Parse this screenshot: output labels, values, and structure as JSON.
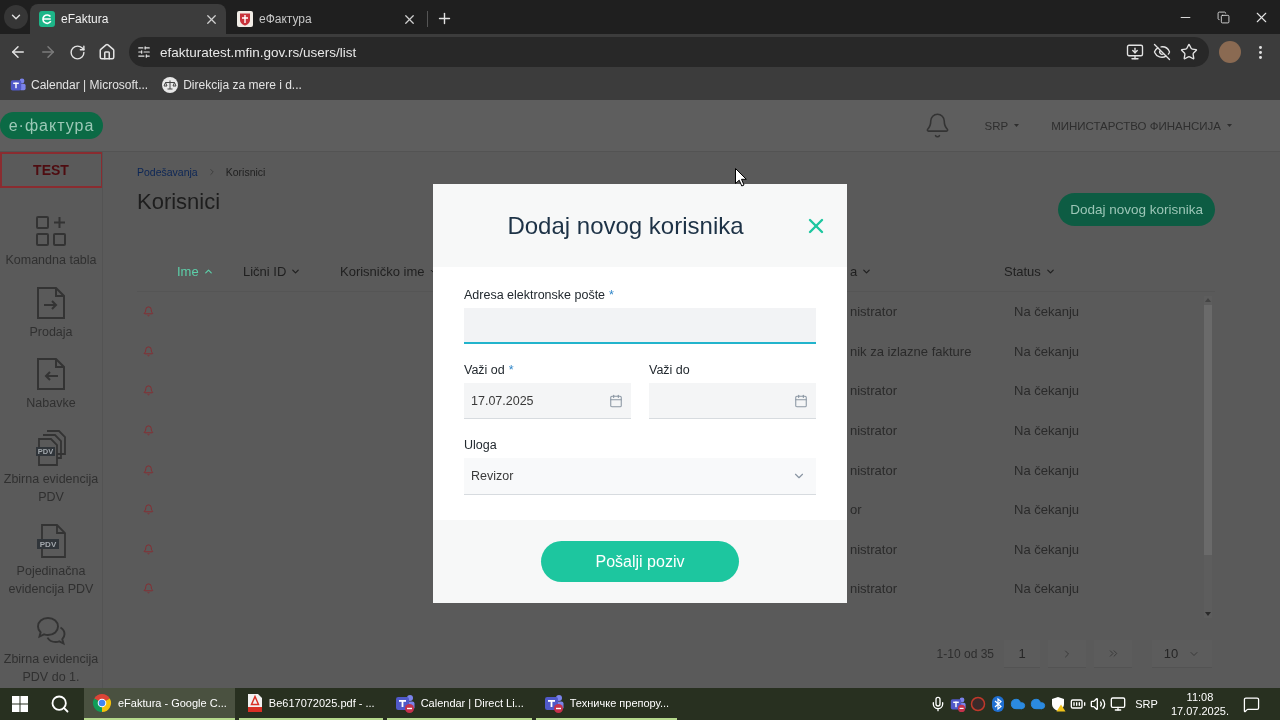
{
  "browser": {
    "tabs": [
      {
        "title": "eFaktura",
        "kind": "efaktura",
        "selected": true
      },
      {
        "title": "еФактура",
        "kind": "crest",
        "selected": false
      }
    ],
    "url": "efakturatest.mfin.gov.rs/users/list",
    "bookmarks": [
      {
        "kind": "teams",
        "label": "Calendar | Microsoft..."
      },
      {
        "kind": "scale",
        "label": "Direkcija za mere i d..."
      }
    ]
  },
  "header": {
    "logo": "e·фактура",
    "language": "SRP",
    "organization": "МИНИСТАРСТВО ФИНАНСИЈА"
  },
  "sidebar": {
    "badge": "TEST",
    "items": [
      {
        "kind": "dashboard",
        "label": "Komandna tabla"
      },
      {
        "kind": "outgoing",
        "label": "Prodaja"
      },
      {
        "kind": "incoming",
        "label": "Nabavke"
      },
      {
        "kind": "pdv-stack",
        "label": "Zbirna evidencija PDV",
        "icon_text": "PDV"
      },
      {
        "kind": "pdv-single",
        "label": "Pojedinačna evidencija PDV",
        "icon_text": "PDV"
      },
      {
        "kind": "chat",
        "label": "Zbirna evidencija PDV do 1."
      }
    ]
  },
  "breadcrumb": [
    {
      "kind": "link",
      "label": "Podešavanja"
    },
    {
      "kind": "current",
      "label": "Korisnici"
    }
  ],
  "page_title": "Korisnici",
  "add_button": "Dodaj novog korisnika",
  "table": {
    "columns": [
      {
        "label": "Ime",
        "selected": true
      },
      {
        "label": "Lični ID",
        "selected": false
      },
      {
        "label": "Korisničko ime",
        "selected": false
      },
      {
        "label": "a",
        "selected": false
      },
      {
        "label": "Status",
        "selected": false
      }
    ],
    "rows": [
      {
        "role": "nistrator",
        "status": "Na čekanju"
      },
      {
        "role": "nik za izlazne fakture",
        "status": "Na čekanju"
      },
      {
        "role": "nistrator",
        "status": "Na čekanju"
      },
      {
        "role": "nistrator",
        "status": "Na čekanju"
      },
      {
        "role": "nistrator",
        "status": "Na čekanju"
      },
      {
        "role": "or",
        "status": "Na čekanju"
      },
      {
        "role": "nistrator",
        "status": "Na čekanju"
      },
      {
        "role": "nistrator",
        "status": "Na čekanju"
      }
    ]
  },
  "pagination": {
    "range": "1-10 od 35",
    "page": "1",
    "page_size": "10"
  },
  "modal": {
    "title": "Dodaj novog korisnika",
    "rows": [
      [
        {
          "kind": "text",
          "label": "Adresa elektronske pošte",
          "required_mark": "*",
          "focused": true
        }
      ],
      [
        {
          "kind": "date",
          "label": "Važi od",
          "required_mark": "*",
          "value": "17.07.2025",
          "focused": false
        },
        {
          "kind": "date",
          "label": "Važi do",
          "focused": false
        }
      ],
      [
        {
          "kind": "select",
          "label": "Uloga",
          "value": "Revizor",
          "focused": false
        }
      ]
    ],
    "submit": "Pošalji poziv"
  },
  "taskbar": {
    "apps": [
      {
        "kind": "chrome",
        "label": "eFaktura - Google C...",
        "selected": true
      },
      {
        "kind": "pdf",
        "label": "Be617072025.pdf - ...",
        "selected": false
      },
      {
        "kind": "teams",
        "label": "Calendar | Direct Li...",
        "selected": false
      },
      {
        "kind": "teams",
        "label": "Техничке препору...",
        "selected": false
      }
    ],
    "language": "SRP",
    "time": "11:08",
    "date": "17.07.2025."
  }
}
